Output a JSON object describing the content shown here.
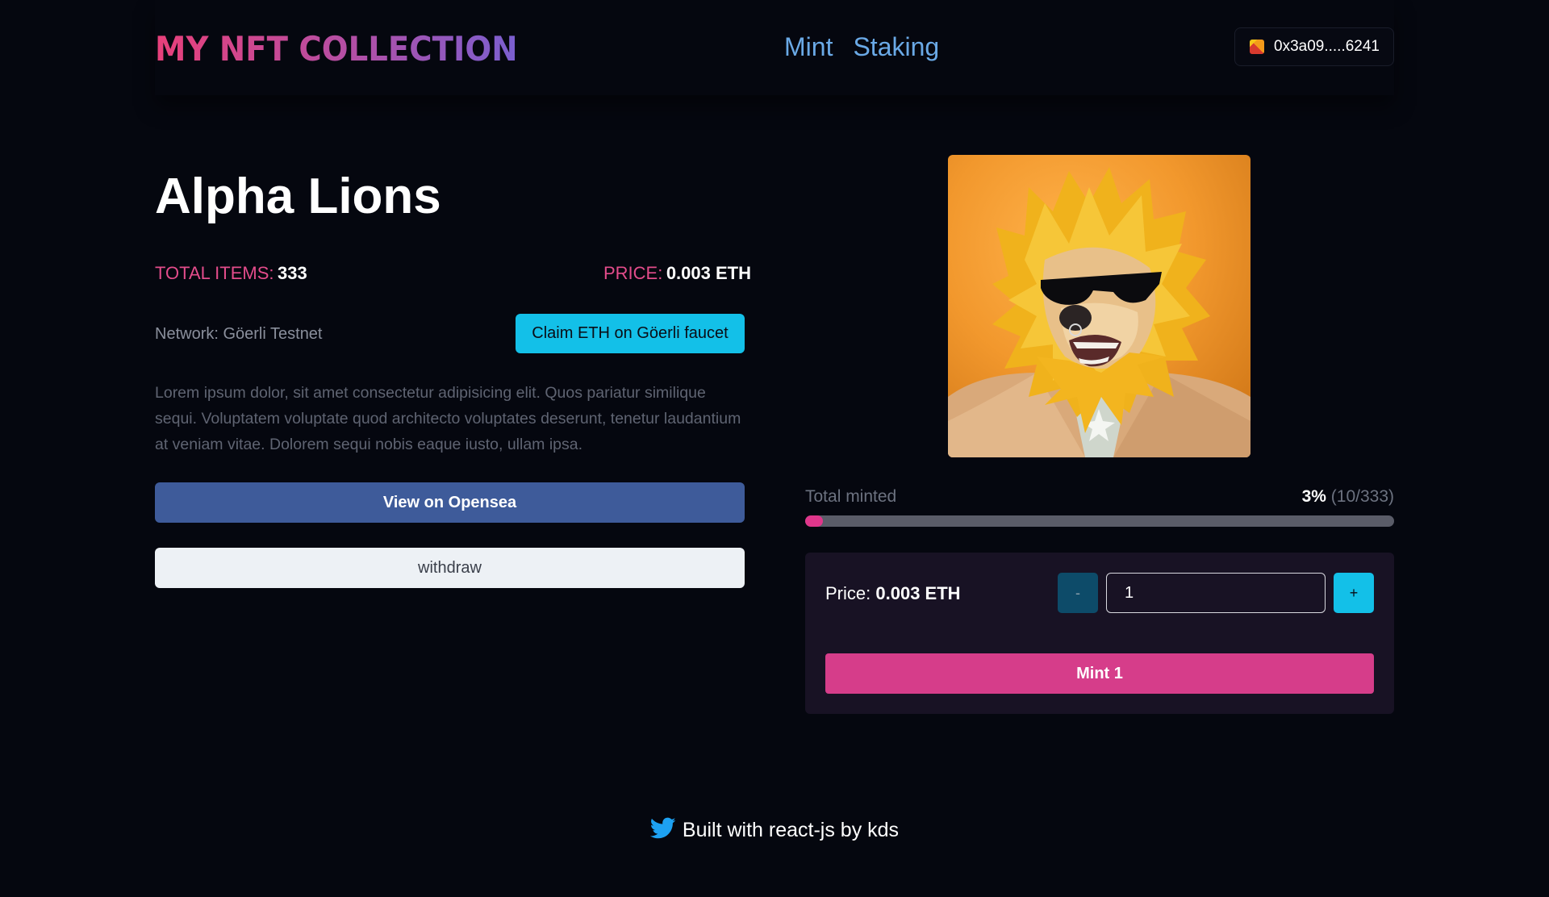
{
  "header": {
    "logo": "MY NFT COLLECTION",
    "nav": [
      {
        "label": "Mint"
      },
      {
        "label": "Staking"
      }
    ],
    "wallet_address": "0x3a09.....6241"
  },
  "collection": {
    "title": "Alpha Lions",
    "total_items_label": "TOTAL ITEMS:",
    "total_items_value": "333",
    "price_label": "PRICE:",
    "price_value": "0.003 ETH",
    "network": "Network: Göerli Testnet",
    "faucet_button": "Claim ETH on Göerli faucet",
    "description": "Lorem ipsum dolor, sit amet consectetur adipisicing elit. Quos pariatur similique sequi. Voluptatem voluptate quod architecto voluptates deserunt, tenetur laudantium at veniam vitae. Dolorem sequi nobis eaque iusto, ullam ipsa.",
    "opensea_button": "View on Opensea",
    "withdraw_button": "withdraw"
  },
  "minting": {
    "total_minted_label": "Total minted",
    "percent": "3%",
    "count": "(10/333)",
    "progress_fraction": 0.03,
    "price_label": "Price:",
    "price_value": "0.003 ETH",
    "minus_label": "-",
    "plus_label": "+",
    "quantity": "1",
    "mint_button": "Mint 1"
  },
  "footer": {
    "text": "Built with react-js by kds",
    "icon": "twitter-icon"
  },
  "colors": {
    "background": "#05070f",
    "accent_pink": "#e34c8b",
    "accent_cyan": "#13c0e8",
    "opensea_blue": "#3e5b9a",
    "card_bg": "#181224"
  }
}
